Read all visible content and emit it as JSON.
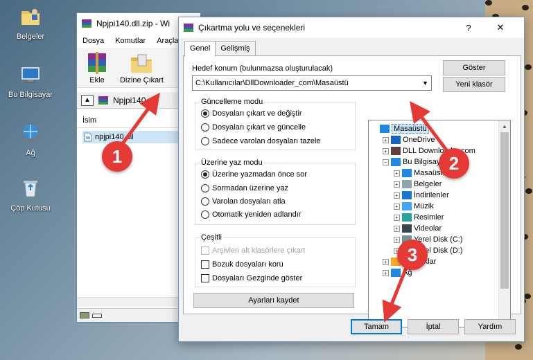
{
  "desktop": {
    "icons": [
      {
        "label": "Belgeler",
        "icon": "documents-folder-icon"
      },
      {
        "label": "Bu Bilgisayar",
        "icon": "computer-icon"
      },
      {
        "label": "Ağ",
        "icon": "network-icon"
      },
      {
        "label": "Çöp Kutusu",
        "icon": "recycle-bin-icon"
      }
    ]
  },
  "winrar": {
    "title": "Npjpi140.dll.zip - Wi",
    "menu": [
      "Dosya",
      "Komutlar",
      "Araçla"
    ],
    "toolbar": {
      "add_label": "Ekle",
      "extract_label": "Dizine Çıkart"
    },
    "path": "Npjpi140.dl",
    "column_name": "İsim",
    "file_name": "npjpi140.dll"
  },
  "dialog": {
    "title": "Çıkartma yolu ve seçenekleri",
    "help_glyph": "?",
    "close_glyph": "✕",
    "tabs": [
      "Genel",
      "Gelişmiş"
    ],
    "destination_label": "Hedef konum (bulunmazsa oluşturulacak)",
    "destination_value": "C:\\Kullanıcılar\\DllDownloader_com\\Masaüstü",
    "show_button": "Göster",
    "new_folder_button": "Yeni klasör",
    "update_mode": {
      "title": "Güncelleme modu",
      "options": [
        "Dosyaları çıkart ve değiştir",
        "Dosyaları çıkart ve güncelle",
        "Sadece varolan dosyaları tazele"
      ],
      "selected": 0
    },
    "overwrite_mode": {
      "title": "Üzerine yaz modu",
      "options": [
        "Üzerine yazmadan önce sor",
        "Sormadan üzerine yaz",
        "Varolan dosyaları atla",
        "Otomatik yeniden adlandır"
      ],
      "selected": 0
    },
    "misc": {
      "title": "Çeşitli",
      "options": [
        "Arşivleri alt klasörlere çıkart",
        "Bozuk dosyaları koru",
        "Dosyaları Gezginde göster"
      ],
      "checked": [
        false,
        false,
        false
      ],
      "disabled": [
        true,
        false,
        false
      ]
    },
    "save_settings_button": "Ayarları kaydet",
    "tree": [
      {
        "label": "Masaüstü",
        "icon": "desktop-icon",
        "level": 0,
        "expander": "",
        "selected": true
      },
      {
        "label": "OneDrive",
        "icon": "onedrive-cloud-icon",
        "level": 1,
        "expander": "+"
      },
      {
        "label": "DLL Downloader.com",
        "icon": "user-icon",
        "level": 1,
        "expander": "+"
      },
      {
        "label": "Bu Bilgisayar",
        "icon": "computer-icon",
        "level": 1,
        "expander": "−"
      },
      {
        "label": "Masaüstü",
        "icon": "desktop-icon",
        "level": 2,
        "expander": "+"
      },
      {
        "label": "Belgeler",
        "icon": "documents-icon",
        "level": 2,
        "expander": "+"
      },
      {
        "label": "İndirilenler",
        "icon": "downloads-icon",
        "level": 2,
        "expander": "+"
      },
      {
        "label": "Müzik",
        "icon": "music-icon",
        "level": 2,
        "expander": "+"
      },
      {
        "label": "Resimler",
        "icon": "pictures-icon",
        "level": 2,
        "expander": "+"
      },
      {
        "label": "Videolar",
        "icon": "videos-icon",
        "level": 2,
        "expander": "+"
      },
      {
        "label": "Yerel Disk (C:)",
        "icon": "drive-icon",
        "level": 2,
        "expander": "+"
      },
      {
        "label": "Yerel Disk (D:)",
        "icon": "drive-icon",
        "level": 2,
        "expander": "+"
      },
      {
        "label": "Kitaplıklar",
        "icon": "libraries-icon",
        "level": 1,
        "expander": "+"
      },
      {
        "label": "Ağ",
        "icon": "network-icon",
        "level": 1,
        "expander": "+"
      }
    ],
    "ok_button": "Tamam",
    "cancel_button": "İptal",
    "help_button": "Yardım"
  },
  "annotations": [
    "1",
    "2",
    "3"
  ],
  "colors": {
    "annotation": "#e53935",
    "selection": "#cce8ff",
    "dialog_bg": "#f0f0f0",
    "default_button_border": "#0078d7"
  }
}
